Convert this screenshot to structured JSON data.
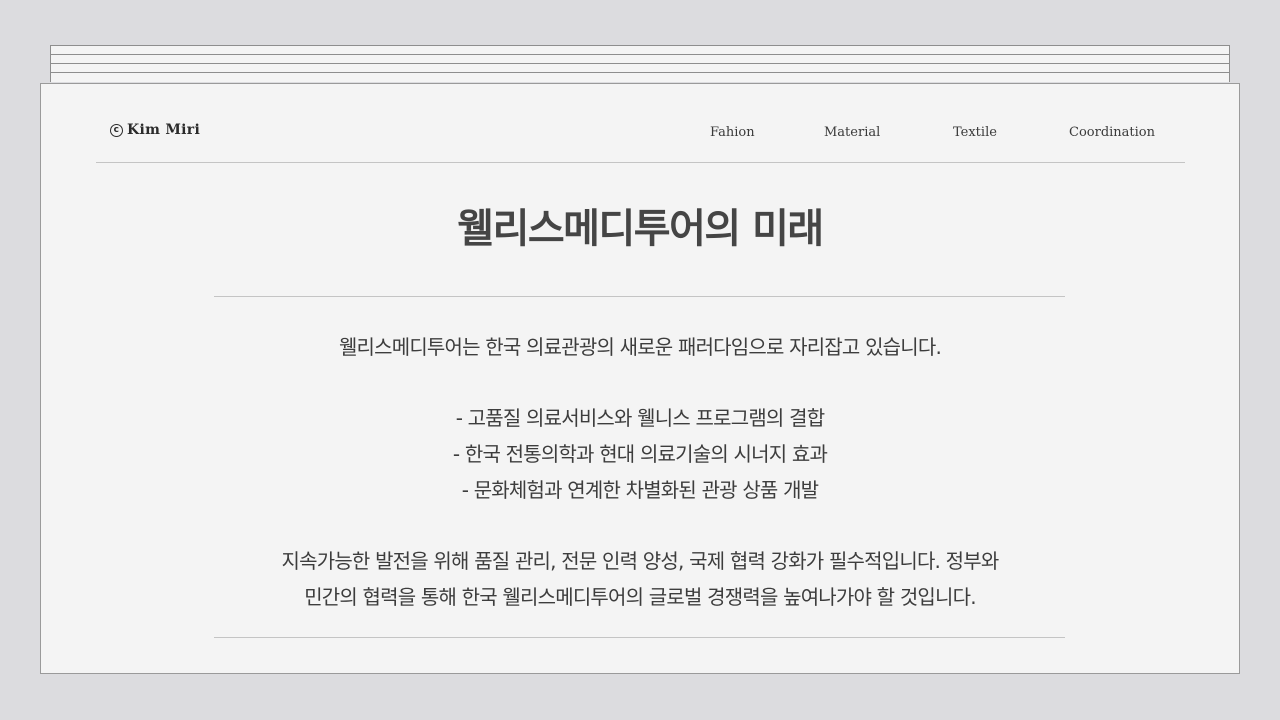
{
  "brand": {
    "copyright_symbol": "c",
    "name": "Kim Miri"
  },
  "nav": {
    "items": [
      "Fahion",
      "Material",
      "Textile",
      "Coordination"
    ]
  },
  "page": {
    "title": "웰리스메디투어의 미래",
    "intro": "웰리스메디투어는 한국 의료관광의 새로운 패러다임으로 자리잡고 있습니다.",
    "bullets": [
      "- 고품질 의료서비스와 웰니스 프로그램의 결합",
      "- 한국 전통의학과 현대 의료기술의 시너지 효과",
      "- 문화체험과 연계한 차별화된 관광 상품 개발"
    ],
    "conclusion": [
      "지속가능한 발전을 위해 품질 관리, 전문 인력 양성, 국제 협력 강화가 필수적입니다. 정부와",
      "민간의 협력을 통해 한국 웰리스메디투어의 글로벌 경쟁력을 높여나가야 할 것입니다."
    ]
  }
}
